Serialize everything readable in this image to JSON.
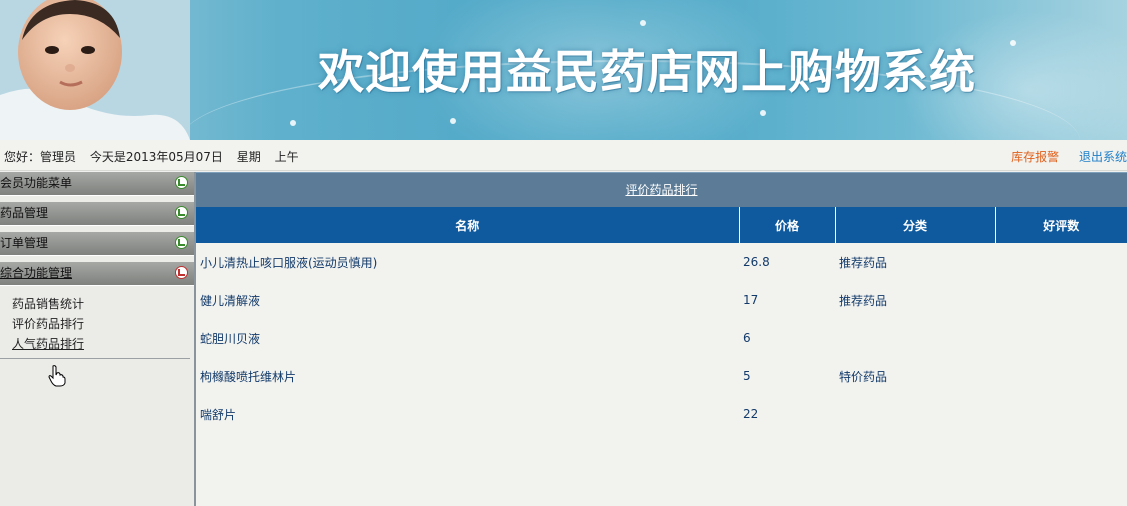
{
  "banner": {
    "title": "欢迎使用益民药店网上购物系统"
  },
  "infobar": {
    "greeting": "您好：管理员",
    "date_text": "今天是2013年05月07日",
    "weekday": "星期",
    "period": "上午",
    "stock_alert_link": "库存报警",
    "logout_link": "退出系统"
  },
  "sidebar": {
    "menus": [
      {
        "label": "会员功能菜单"
      },
      {
        "label": "药品管理"
      },
      {
        "label": "订单管理"
      },
      {
        "label": "综合功能管理"
      }
    ],
    "submenu": [
      {
        "label": "药品销售统计"
      },
      {
        "label": "评价药品排行"
      },
      {
        "label": "人气药品排行"
      }
    ]
  },
  "main": {
    "title": "评价药品排行",
    "columns": [
      "名称",
      "价格",
      "分类",
      "好评数"
    ],
    "rows": [
      {
        "name": "小儿清热止咳口服液(运动员慎用)",
        "price": "26.8",
        "category": "推荐药品",
        "reviews": ""
      },
      {
        "name": "健儿清解液",
        "price": "17",
        "category": "推荐药品",
        "reviews": ""
      },
      {
        "name": "蛇胆川贝液",
        "price": "6",
        "category": "",
        "reviews": ""
      },
      {
        "name": "枸橼酸喷托维林片",
        "price": "5",
        "category": "特价药品",
        "reviews": ""
      },
      {
        "name": "喘舒片",
        "price": "22",
        "category": "",
        "reviews": ""
      }
    ]
  },
  "colors": {
    "header_blue": "#0f5a9e",
    "title_bar": "#5b7b97",
    "stock_link": "#e0601b",
    "logout_link": "#1f7fc7"
  }
}
